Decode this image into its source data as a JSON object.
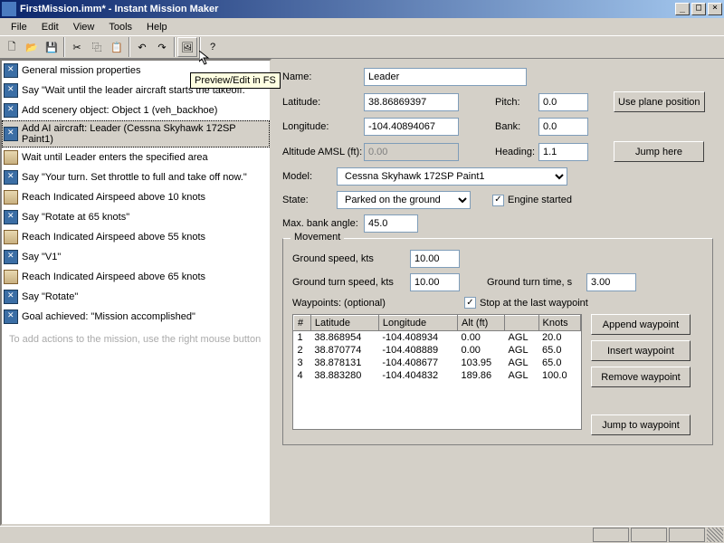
{
  "window": {
    "title": "FirstMission.imm* - Instant Mission Maker"
  },
  "menus": [
    "File",
    "Edit",
    "View",
    "Tools",
    "Help"
  ],
  "tooltip": "Preview/Edit in FS",
  "actions": [
    {
      "icon": "blue",
      "text": "General mission properties"
    },
    {
      "icon": "blue",
      "text": "Say \"Wait until the leader aircraft starts the takeoff.\""
    },
    {
      "icon": "blue",
      "text": "Add scenery object: Object  1 (veh_backhoe)"
    },
    {
      "icon": "blue",
      "text": "Add AI aircraft: Leader (Cessna Skyhawk 172SP Paint1)",
      "sel": true
    },
    {
      "icon": "tan",
      "text": "Wait until Leader enters the specified area"
    },
    {
      "icon": "blue",
      "text": "Say \"Your turn. Set throttle to full and take off now.\""
    },
    {
      "icon": "tan",
      "text": "Reach Indicated Airspeed above 10 knots"
    },
    {
      "icon": "blue",
      "text": "Say \"Rotate at 65 knots\""
    },
    {
      "icon": "tan",
      "text": "Reach Indicated Airspeed above 55 knots"
    },
    {
      "icon": "blue",
      "text": "Say \"V1\""
    },
    {
      "icon": "tan",
      "text": "Reach Indicated Airspeed above 65 knots"
    },
    {
      "icon": "blue",
      "text": "Say \"Rotate\""
    },
    {
      "icon": "blue",
      "text": "Goal achieved: \"Mission accomplished\""
    }
  ],
  "hint": "To add actions to the mission, use the right mouse button",
  "form": {
    "name_lbl": "Name:",
    "name": "Leader",
    "lat_lbl": "Latitude:",
    "lat": "38.86869397",
    "lon_lbl": "Longitude:",
    "lon": "-104.40894067",
    "alt_lbl": "Altitude AMSL (ft):",
    "alt": "0.00",
    "pitch_lbl": "Pitch:",
    "pitch": "0.0",
    "bank_lbl": "Bank:",
    "bank": "0.0",
    "heading_lbl": "Heading:",
    "heading": "1.1",
    "model_lbl": "Model:",
    "model": "Cessna Skyhawk 172SP Paint1",
    "state_lbl": "State:",
    "state": "Parked on the ground",
    "engine_lbl": "Engine started",
    "maxbank_lbl": "Max. bank angle:",
    "maxbank": "45.0",
    "useplane": "Use plane position",
    "jump": "Jump here"
  },
  "movement": {
    "title": "Movement",
    "gs_lbl": "Ground speed, kts",
    "gs": "10.00",
    "gts_lbl": "Ground turn speed, kts",
    "gts": "10.00",
    "gtt_lbl": "Ground turn time, s",
    "gtt": "3.00",
    "wp_lbl": "Waypoints: (optional)",
    "stop_lbl": "Stop at the last waypoint",
    "cols": [
      "#",
      "Latitude",
      "Longitude",
      "Alt (ft)",
      "",
      "Knots"
    ],
    "rows": [
      [
        "1",
        "38.868954",
        "-104.408934",
        "0.00",
        "AGL",
        "20.0"
      ],
      [
        "2",
        "38.870774",
        "-104.408889",
        "0.00",
        "AGL",
        "65.0"
      ],
      [
        "3",
        "38.878131",
        "-104.408677",
        "103.95",
        "AGL",
        "65.0"
      ],
      [
        "4",
        "38.883280",
        "-104.404832",
        "189.86",
        "AGL",
        "100.0"
      ]
    ],
    "btns": {
      "append": "Append waypoint",
      "insert": "Insert waypoint",
      "remove": "Remove waypoint",
      "jumpwp": "Jump to waypoint"
    }
  }
}
